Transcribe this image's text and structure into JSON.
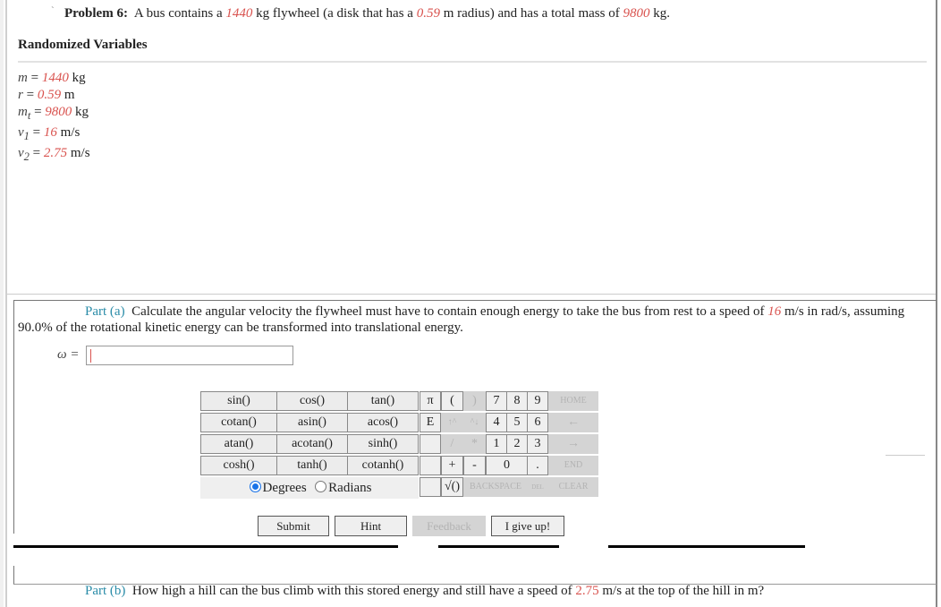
{
  "problem": {
    "label": "Problem 6:",
    "text_parts": [
      "A bus contains a ",
      "1440",
      " kg flywheel (a disk that has a ",
      "0.59",
      " m radius) and has a total mass of ",
      "9800",
      " kg."
    ]
  },
  "randomized_variables": {
    "title": "Randomized Variables",
    "items": [
      {
        "symbol": "m",
        "sub": "",
        "eq": " = ",
        "value": "1440",
        "unit": " kg"
      },
      {
        "symbol": "r",
        "sub": "",
        "eq": " = ",
        "value": "0.59",
        "unit": " m"
      },
      {
        "symbol": "m",
        "sub": "t",
        "eq": " = ",
        "value": "9800",
        "unit": " kg"
      },
      {
        "symbol": "v",
        "sub": "1",
        "eq": " = ",
        "value": "16",
        "unit": " m/s"
      },
      {
        "symbol": "v",
        "sub": "2",
        "eq": " = ",
        "value": "2.75",
        "unit": " m/s"
      }
    ]
  },
  "part_a": {
    "label": "Part (a)",
    "text_parts": [
      "Calculate the angular velocity the flywheel must have to contain enough energy to take the bus from rest to a speed of ",
      "16",
      " m/s in rad/s, assuming 90.0% of the rotational kinetic energy can be transformed into translational energy."
    ],
    "answer_label": "ω =",
    "answer_value": ""
  },
  "calculator": {
    "functions": [
      [
        "sin()",
        "cos()",
        "tan()"
      ],
      [
        "cotan()",
        "asin()",
        "acos()"
      ],
      [
        "atan()",
        "acotan()",
        "sinh()"
      ],
      [
        "cosh()",
        "tanh()",
        "cotanh()"
      ]
    ],
    "angle_mode": {
      "degrees": "Degrees",
      "radians": "Radians",
      "selected": "Degrees"
    },
    "keys": {
      "pi": "π",
      "lparen": "(",
      "rparen": ")",
      "e": "E",
      "up": "↑^",
      "down": "^↓",
      "div": "/",
      "mul": "*",
      "plus": "+",
      "minus": "-",
      "sqrt": "√()",
      "n7": "7",
      "n8": "8",
      "n9": "9",
      "n4": "4",
      "n5": "5",
      "n6": "6",
      "n1": "1",
      "n2": "2",
      "n3": "3",
      "n0": "0",
      "dot": ".",
      "home": "HOME",
      "left": "←",
      "right": "→",
      "end": "END",
      "backspace": "BACKSPACE",
      "del": "DEL",
      "clear": "CLEAR"
    }
  },
  "actions": {
    "submit": "Submit",
    "hint": "Hint",
    "feedback": "Feedback",
    "give_up": "I give up!"
  },
  "part_b": {
    "label": "Part (b)",
    "text_parts": [
      "How high a hill can the bus climb with this stored energy and still have a speed of ",
      "2.75",
      " m/s at the top of the hill in m?"
    ]
  },
  "colors": {
    "randomized": "#d9534f",
    "part_label": "#2a8ca8"
  }
}
